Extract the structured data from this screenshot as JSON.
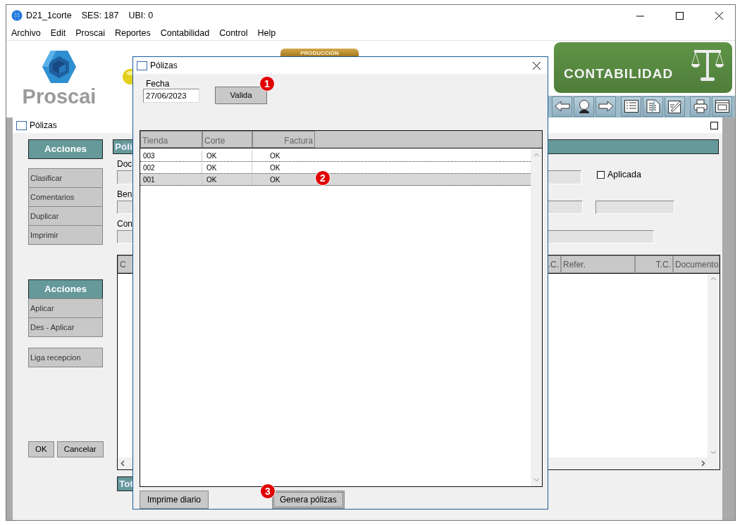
{
  "window": {
    "title": "D21_1corte",
    "session": "SES: 187",
    "location": "UBI: 0"
  },
  "menu": [
    "Archivo",
    "Edit",
    "Proscai",
    "Reportes",
    "Contabilidad",
    "Control",
    "Help"
  ],
  "header": {
    "logo_text": "Proscai",
    "partial_banner": "PRODUCCIÓN",
    "module_banner": "CONTABILIDAD"
  },
  "document_window": {
    "title": "Pólizas",
    "action_groups": [
      {
        "heading": "Acciones",
        "items": [
          "Clasificar",
          "Comentarios",
          "Duplicar",
          "Imprimir"
        ]
      },
      {
        "heading": "Acciones",
        "items": [
          "Aplicar",
          "Des - Aplicar"
        ]
      }
    ],
    "extra_button": "Liga recepcion",
    "ok_button": "OK",
    "cancel_button": "Cancelar",
    "section_header": "Póli",
    "field_labels": [
      "Doc",
      "Ben",
      "Con"
    ],
    "applied": {
      "label": "Aplicada",
      "checked": false
    },
    "grid_columns": [
      "C",
      ".C.",
      "Refer.",
      "T.C.",
      "Documento"
    ],
    "totals_label": "Tot"
  },
  "dialog": {
    "title": "Pólizas",
    "date_label": "Fecha",
    "date_value": "27/06/2023",
    "validate_button": "Valida",
    "columns": [
      "Tienda",
      "Corte",
      "Factura"
    ],
    "rows": [
      {
        "cells": [
          "003",
          "OK",
          "OK"
        ],
        "selected": false
      },
      {
        "cells": [
          "002",
          "OK",
          "OK"
        ],
        "selected": false
      },
      {
        "cells": [
          "001",
          "OK",
          "OK"
        ],
        "selected": true
      }
    ],
    "buttons": [
      {
        "label": "Imprime diario",
        "focused": false
      },
      {
        "label": "Genera pólizas",
        "focused": true
      }
    ]
  },
  "markers": [
    "1",
    "2",
    "3"
  ]
}
